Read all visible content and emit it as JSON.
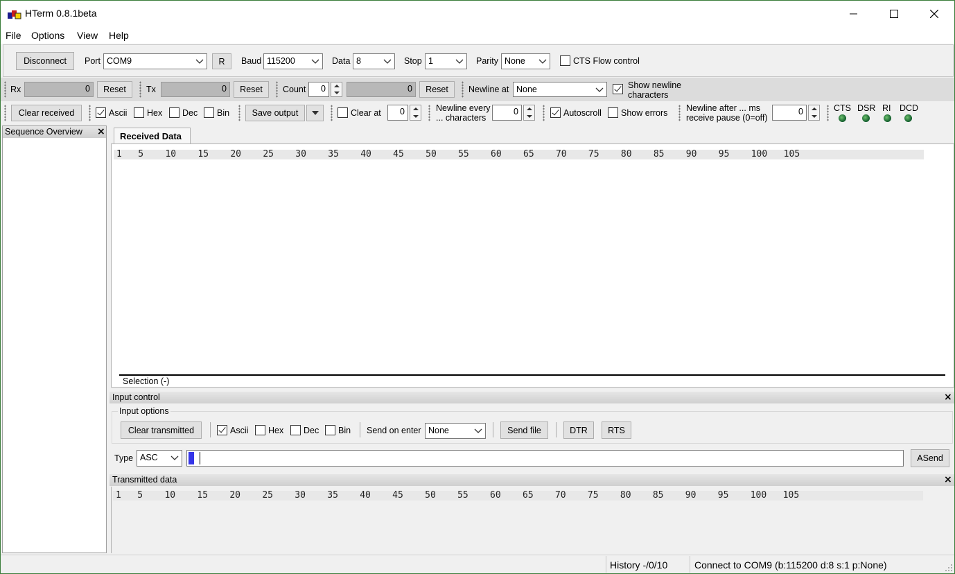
{
  "app": {
    "title": "HTerm 0.8.1beta"
  },
  "menu": [
    "File",
    "Options",
    "View",
    "Help"
  ],
  "conn": {
    "disconnect": "Disconnect",
    "port_label": "Port",
    "port_value": "COM9",
    "r_button": "R",
    "baud_label": "Baud",
    "baud_value": "115200",
    "data_label": "Data",
    "data_value": "8",
    "stop_label": "Stop",
    "stop_value": "1",
    "parity_label": "Parity",
    "parity_value": "None",
    "cts_label": "CTS Flow control"
  },
  "counters": {
    "rx_label": "Rx",
    "rx_value": "0",
    "rx_reset": "Reset",
    "tx_label": "Tx",
    "tx_value": "0",
    "tx_reset": "Reset",
    "count_label": "Count",
    "count_value": "0",
    "count_bar": "0",
    "count_reset": "Reset",
    "newline_at_label": "Newline at",
    "newline_at_value": "None",
    "show_newline_line1": "Show newline",
    "show_newline_line2": "characters"
  },
  "display": {
    "clear_received": "Clear received",
    "ascii": "Ascii",
    "hex": "Hex",
    "dec": "Dec",
    "bin": "Bin",
    "save_output": "Save output",
    "clear_at": "Clear at",
    "clear_at_value": "0",
    "newline_every_line1": "Newline every",
    "newline_every_line2": "... characters",
    "newline_every_value": "0",
    "autoscroll": "Autoscroll",
    "show_errors": "Show errors",
    "newline_after_line1": "Newline after ... ms",
    "newline_after_line2": "receive pause (0=off)",
    "newline_after_value": "0",
    "signals": [
      "CTS",
      "DSR",
      "RI",
      "DCD"
    ]
  },
  "sequence": {
    "title": "Sequence Overview",
    "close": "×"
  },
  "received": {
    "tab": "Received Data",
    "ruler": "1   5    10    15    20    25    30    35    40    45    50    55    60    65    70    75    80    85    90    95    100   105",
    "selection": "Selection (-)"
  },
  "input_control": {
    "title": "Input control",
    "close": "×",
    "options_label": "Input options",
    "clear_transmitted": "Clear transmitted",
    "ascii": "Ascii",
    "hex": "Hex",
    "dec": "Dec",
    "bin": "Bin",
    "send_on_enter_label": "Send on enter",
    "send_on_enter_value": "None",
    "send_file": "Send file",
    "dtr": "DTR",
    "rts": "RTS",
    "type_label": "Type",
    "type_value": "ASC",
    "send_button": "ASend"
  },
  "transmitted": {
    "title": "Transmitted data",
    "close": "×",
    "ruler": "1   5    10    15    20    25    30    35    40    45    50    55    60    65    70    75    80    85    90    95    100   105"
  },
  "status": {
    "history": "History -/0/10",
    "connection": "Connect to COM9 (b:115200 d:8 s:1 p:None)"
  }
}
